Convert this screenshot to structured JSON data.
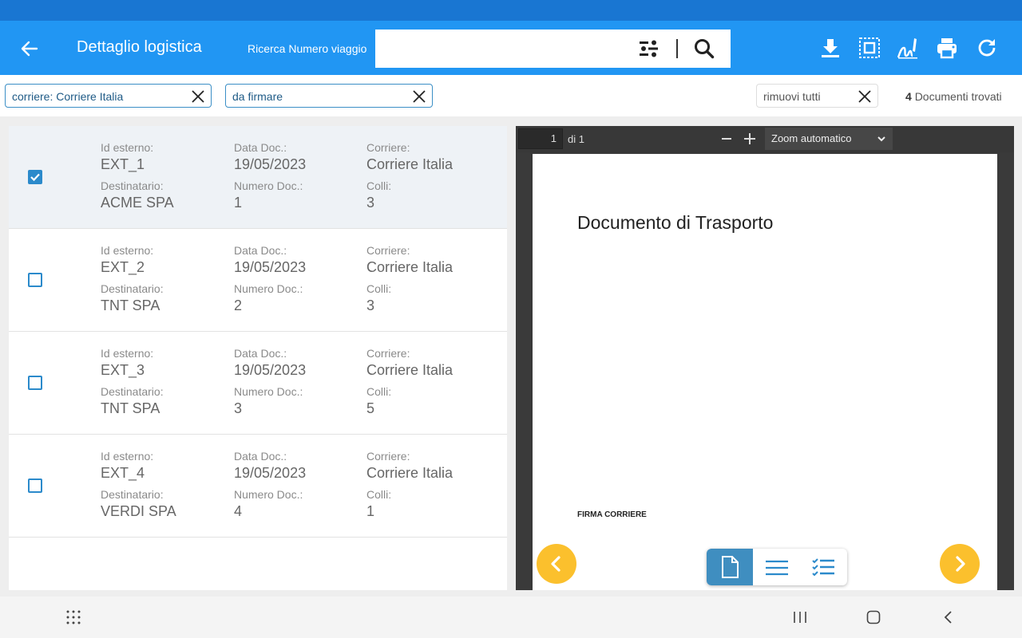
{
  "colors": {
    "primary": "#2196f3",
    "statusbar": "#1976d2",
    "chip_border": "#3b8fc6",
    "accent_yellow": "#fbc02d",
    "selected_row": "#eef2f6"
  },
  "appbar": {
    "title": "Dettaglio logistica",
    "search_label": "Ricerca Numero viaggio",
    "search_value": "",
    "icons": [
      "back-arrow-icon",
      "filter-icon",
      "search-icon",
      "download-icon",
      "select-all-icon",
      "sign-icon",
      "print-icon",
      "refresh-icon"
    ]
  },
  "filters": {
    "chips": [
      {
        "label": "corriere: Corriere Italia"
      },
      {
        "label": "da firmare"
      }
    ],
    "clear_all_label": "rimuovi tutti",
    "found_count": "4",
    "found_text": "Documenti trovati"
  },
  "documents": {
    "labels": {
      "id": "Id esterno:",
      "date": "Data Doc.:",
      "carrier": "Corriere:",
      "recipient": "Destinatario:",
      "number": "Numero Doc.:",
      "packages": "Colli:"
    },
    "rows": [
      {
        "checked": true,
        "id": "EXT_1",
        "date": "19/05/2023",
        "carrier": "Corriere Italia",
        "recipient": "ACME SPA",
        "number": "1",
        "packages": "3"
      },
      {
        "checked": false,
        "id": "EXT_2",
        "date": "19/05/2023",
        "carrier": "Corriere Italia",
        "recipient": "TNT SPA",
        "number": "2",
        "packages": "3"
      },
      {
        "checked": false,
        "id": "EXT_3",
        "date": "19/05/2023",
        "carrier": "Corriere Italia",
        "recipient": "TNT SPA",
        "number": "3",
        "packages": "5"
      },
      {
        "checked": false,
        "id": "EXT_4",
        "date": "19/05/2023",
        "carrier": "Corriere Italia",
        "recipient": "VERDI SPA",
        "number": "4",
        "packages": "1"
      }
    ]
  },
  "viewer": {
    "page_number": "1",
    "page_total": "di 1",
    "zoom": "Zoom automatico",
    "doc_title": "Documento di Trasporto",
    "signature_label": "FIRMA CORRIERE",
    "view_modes": [
      "document-view-icon",
      "list-view-icon",
      "checklist-view-icon"
    ]
  },
  "navbar": {
    "icons": [
      "apps-grid-icon",
      "recents-icon",
      "home-icon",
      "back-icon"
    ]
  }
}
